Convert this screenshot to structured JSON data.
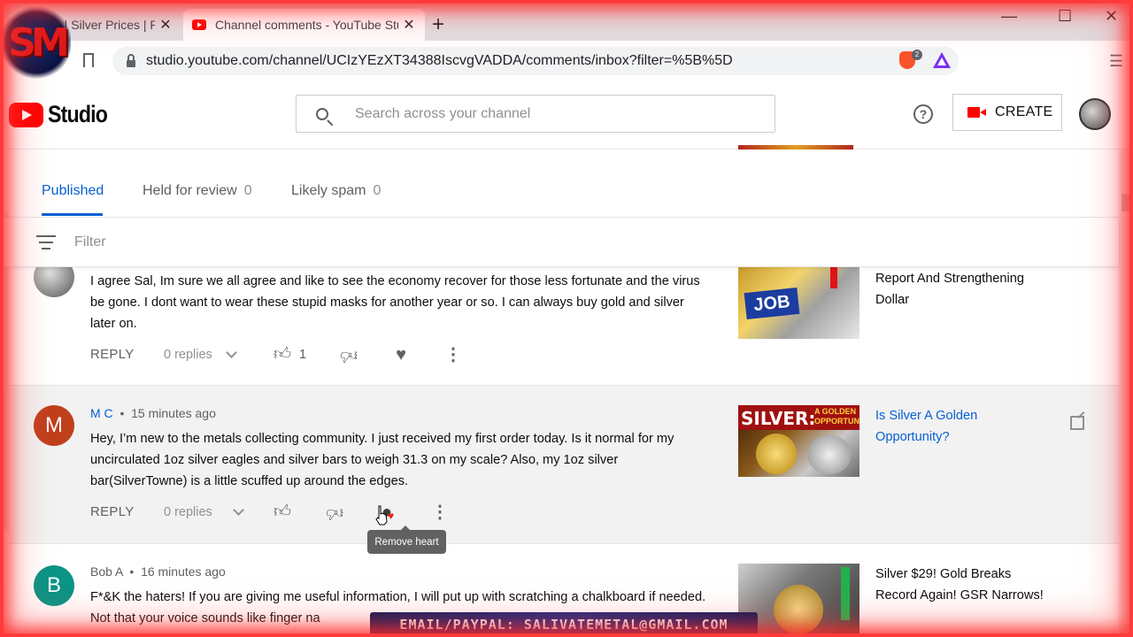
{
  "browser": {
    "tabs": [
      {
        "title": "es | Silver Prices | Pl",
        "active": false
      },
      {
        "title": "Channel comments - YouTube Stu",
        "active": true
      }
    ],
    "url": "studio.youtube.com/channel/UCIzYEzXT34388IscvgVADDA/comments/inbox?filter=%5B%5D",
    "extension_badge": "2",
    "window_controls": {
      "minimize": "—",
      "maximize": "☐",
      "close": "✕"
    }
  },
  "channel_logo": {
    "text": "SM"
  },
  "studio_header": {
    "logo_text": "Studio",
    "search_placeholder": "Search across your channel",
    "help_glyph": "?",
    "create_label": "CREATE"
  },
  "comment_tabs": [
    {
      "label": "Published",
      "count": "",
      "active": true
    },
    {
      "label": "Held for review",
      "count": "0",
      "active": false
    },
    {
      "label": "Likely spam",
      "count": "0",
      "active": false
    }
  ],
  "filter": {
    "label": "Filter"
  },
  "comments": [
    {
      "author": "",
      "time": "",
      "text": "I agree Sal, Im sure we all agree and like to see the economy recover for those less fortunate and the virus be gone. I dont want to wear these stupid masks for another year or so. I can always buy gold and silver later on.",
      "reply_label": "REPLY",
      "replies": "0 replies",
      "likes": "1",
      "video_title": "Report And Strengthening Dollar",
      "video_thumb_text": "JOB"
    },
    {
      "author": "M C",
      "avatar_letter": "M",
      "time": "15 minutes ago",
      "text": "Hey, I’m new to the metals collecting community. I just received my first order today. Is it normal for my uncirculated 1oz silver eagles and silver bars to weigh 31.3 on my scale? Also, my 1oz silver bar(SilverTowne) is a little scuffed up around the edges.",
      "reply_label": "REPLY",
      "replies": "0 replies",
      "likes": "",
      "video_title": "Is Silver A Golden Opportunity?",
      "video_thumb_text": "SILVER:",
      "video_thumb_subtext": "A GOLDEN OPPORTUNITY"
    },
    {
      "author": "Bob A",
      "avatar_letter": "B",
      "time": "16 minutes ago",
      "text": "F*&K the haters! If you are giving me useful information, I will put up with scratching a chalkboard if needed. Not that your voice sounds like finger na",
      "video_title": "Silver $29! Gold Breaks Record Again! GSR Narrows!"
    }
  ],
  "tooltip": {
    "text": "Remove heart"
  },
  "email_banner": {
    "text": "EMAIL/PAYPAL: SALIVATEMETAL@GMAIL.COM"
  },
  "colors": {
    "accent_blue": "#065fd4",
    "youtube_red": "#ff0000",
    "avatar_m": "#c0401c",
    "avatar_b": "#0a9485"
  }
}
